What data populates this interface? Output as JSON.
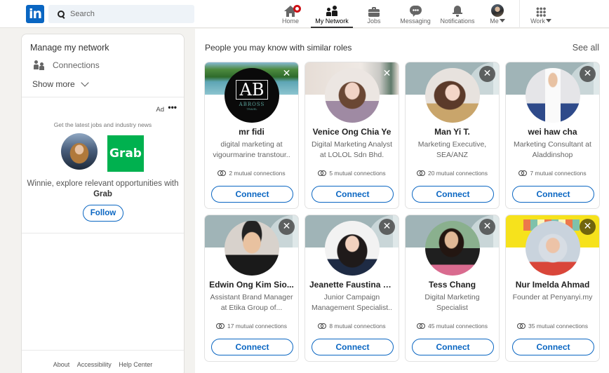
{
  "topbar": {
    "logo_text": "in",
    "search_placeholder": "Search",
    "nav": [
      {
        "label": "Home",
        "icon": "home-icon",
        "has_badge": true
      },
      {
        "label": "My Network",
        "icon": "my-network-icon",
        "active": true
      },
      {
        "label": "Jobs",
        "icon": "briefcase-icon"
      },
      {
        "label": "Messaging",
        "icon": "chat-bubble-icon"
      },
      {
        "label": "Notifications",
        "icon": "bell-icon"
      },
      {
        "label": "Me",
        "icon": "profile-avatar",
        "dropdown": true
      },
      {
        "label": "Work",
        "icon": "grid-apps-icon",
        "dropdown": true
      }
    ]
  },
  "sidebar": {
    "title": "Manage my network",
    "connections_label": "Connections",
    "show_more_label": "Show more",
    "ad": {
      "label": "Ad",
      "more_label": "•••",
      "tagline": "Get the latest jobs and industry news",
      "logo_text": "Grab",
      "message_prefix": "Winnie, explore relevant opportunities with ",
      "company": "Grab",
      "follow_label": "Follow",
      "brand_color": "#00b14f"
    },
    "footer": {
      "links": [
        "About",
        "Accessibility",
        "Help Center"
      ]
    }
  },
  "main": {
    "title": "People you may know with similar roles",
    "see_all_label": "See all",
    "connect_label": "Connect",
    "dismiss_label": "✕",
    "cards": [
      {
        "name": "mr fidi",
        "headline": "digital marketing at vigourmarine transtour..",
        "mutual": "2 mutual connections",
        "avatar_text": "AB",
        "avatar_brand": "ABROSS",
        "avatar_sub": "TRAVEL"
      },
      {
        "name": "Venice Ong Chia Ye",
        "headline": "Digital Marketing Analyst at LOLOL Sdn Bhd.",
        "mutual": "5 mutual connections"
      },
      {
        "name": "Man Yi T.",
        "headline": "Marketing Executive, SEA/ANZ",
        "mutual": "20 mutual connections"
      },
      {
        "name": "wei haw cha",
        "headline": "Marketing Consultant at Aladdinshop",
        "mutual": "7 mutual connections"
      },
      {
        "name": "Edwin Ong Kim Sio...",
        "headline": "Assistant Brand Manager at Etika Group of...",
        "mutual": "17 mutual connections"
      },
      {
        "name": "Jeanette Faustina Ef..",
        "headline": "Junior Campaign Management Specialist..",
        "mutual": "8 mutual connections"
      },
      {
        "name": "Tess Chang",
        "headline": "Digital Marketing Specialist",
        "mutual": "45 mutual connections"
      },
      {
        "name": "Nur Imelda Ahmad",
        "headline": "Founder at Penyanyi.my",
        "mutual": "35 mutual connections"
      }
    ]
  },
  "colors": {
    "brand_blue": "#0a66c2",
    "notification_red": "#cc1016",
    "page_bg": "#f3f2ef"
  }
}
